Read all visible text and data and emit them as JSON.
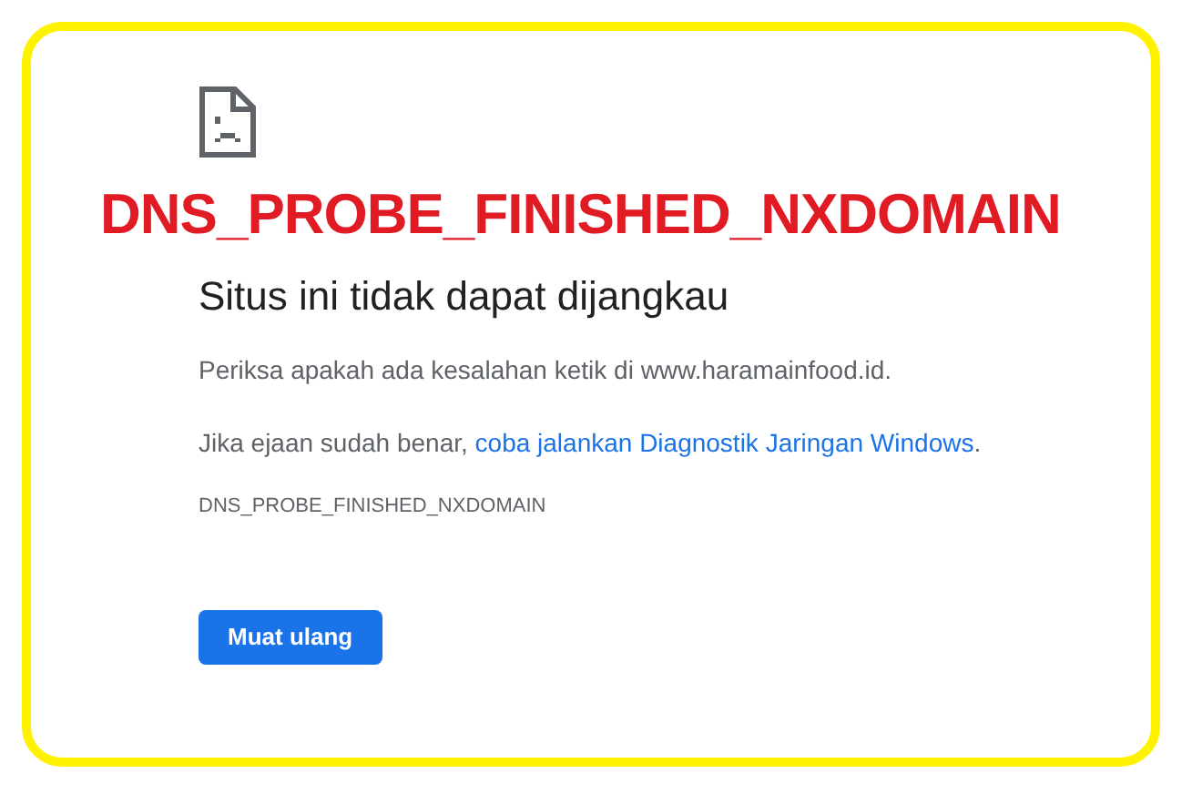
{
  "overlay_caption": "DNS_PROBE_FINISHED_NXDOMAIN",
  "error_page": {
    "heading": "Situs ini tidak dapat dijangkau",
    "message": "Periksa apakah ada kesalahan ketik di www.haramainfood.id.",
    "suggestion": {
      "prefix": "Jika ejaan sudah benar, ",
      "link": "coba jalankan Diagnostik Jaringan Windows",
      "suffix": "."
    },
    "error_code": "DNS_PROBE_FINISHED_NXDOMAIN",
    "buttons": [
      "Muat ulang"
    ]
  }
}
